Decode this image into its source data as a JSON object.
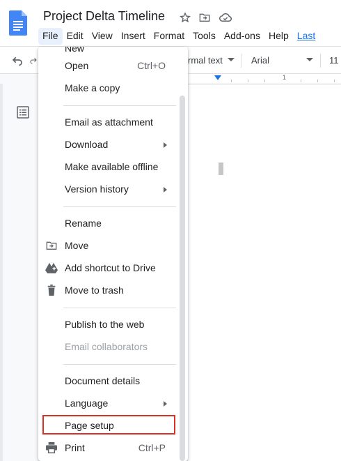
{
  "document": {
    "title": "Project Delta Timeline"
  },
  "menubar": {
    "items": [
      "File",
      "Edit",
      "View",
      "Insert",
      "Format",
      "Tools",
      "Add-ons",
      "Help"
    ],
    "last_edit": "Last"
  },
  "toolbar": {
    "style": "rmal text",
    "font": "Arial",
    "size": "11"
  },
  "ruler": {
    "marker_number": "1"
  },
  "file_menu": {
    "partial_top": "New",
    "items": [
      {
        "label": "Open",
        "shortcut": "Ctrl+O"
      },
      {
        "label": "Make a copy"
      },
      {
        "label": "Email as attachment"
      },
      {
        "label": "Download",
        "submenu": true
      },
      {
        "label": "Make available offline"
      },
      {
        "label": "Version history",
        "submenu": true
      },
      {
        "label": "Rename"
      },
      {
        "label": "Move",
        "icon": "move-folder-icon"
      },
      {
        "label": "Add shortcut to Drive",
        "icon": "drive-shortcut-icon"
      },
      {
        "label": "Move to trash",
        "icon": "trash-icon"
      },
      {
        "label": "Publish to the web"
      },
      {
        "label": "Email collaborators",
        "disabled": true
      },
      {
        "label": "Document details"
      },
      {
        "label": "Language",
        "submenu": true
      },
      {
        "label": "Page setup",
        "highlighted": true
      },
      {
        "label": "Print",
        "shortcut": "Ctrl+P",
        "icon": "print-icon"
      }
    ]
  },
  "colors": {
    "accent": "#1a73e8",
    "highlight_border": "#d93025",
    "docs_blue": "#4285f4"
  }
}
